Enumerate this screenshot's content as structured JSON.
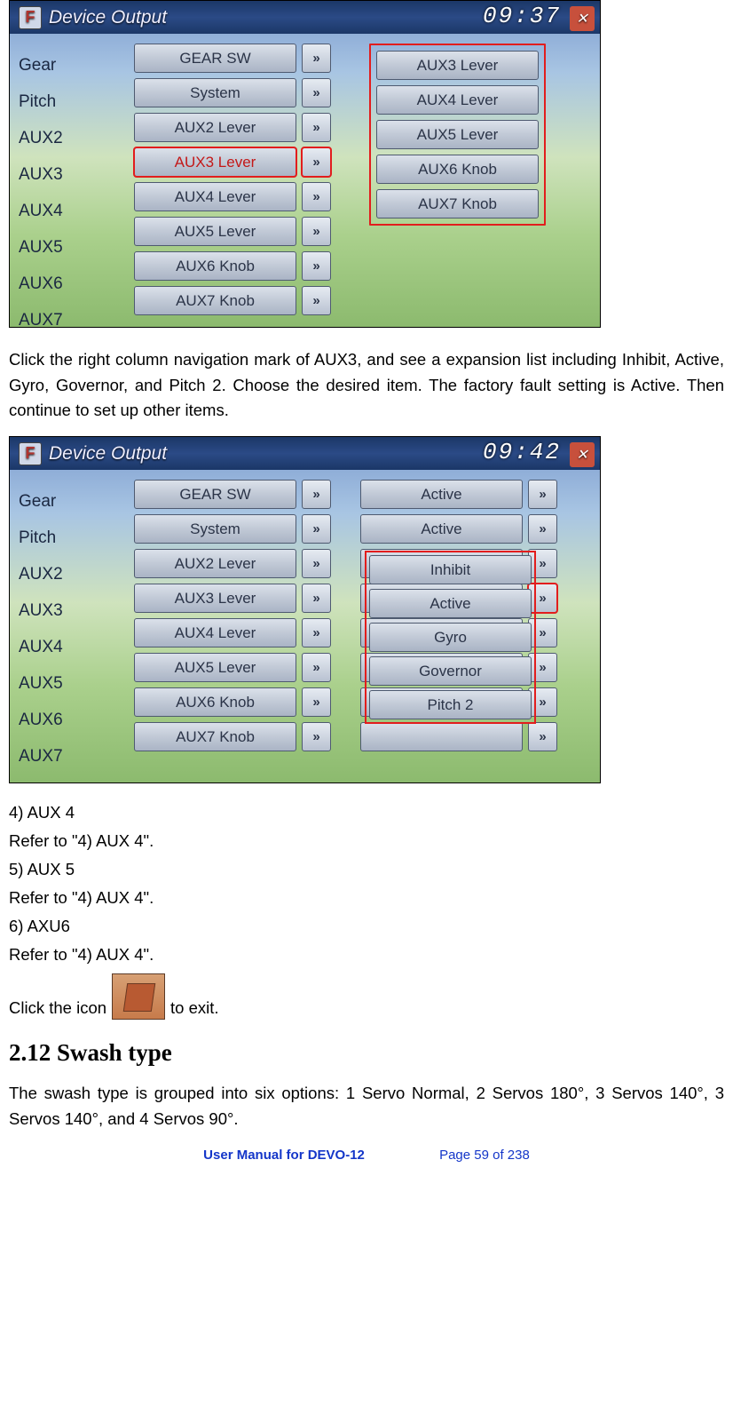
{
  "shotA": {
    "title": "Device Output",
    "clock": "09:37",
    "labels": [
      "Gear",
      "Pitch",
      "AUX2",
      "AUX3",
      "AUX4",
      "AUX5",
      "AUX6",
      "AUX7"
    ],
    "left_buttons": [
      "GEAR SW",
      "System",
      "AUX2 Lever",
      "AUX3 Lever",
      "AUX4 Lever",
      "AUX5 Lever",
      "AUX6 Knob",
      "AUX7 Knob"
    ],
    "popup": [
      "AUX3 Lever",
      "AUX4 Lever",
      "AUX5 Lever",
      "AUX6 Knob",
      "AUX7 Knob"
    ],
    "highlight_row_index": 3
  },
  "para1": "Click the right column navigation mark of AUX3, and see a expansion list including Inhibit, Active, Gyro, Governor, and Pitch 2. Choose the desired item. The factory fault setting is Active. Then continue to set up other items.",
  "shotB": {
    "title": "Device Output",
    "clock": "09:42",
    "labels": [
      "Gear",
      "Pitch",
      "AUX2",
      "AUX3",
      "AUX4",
      "AUX5",
      "AUX6",
      "AUX7"
    ],
    "left_buttons": [
      "GEAR SW",
      "System",
      "AUX2 Lever",
      "AUX3 Lever",
      "AUX4 Lever",
      "AUX5 Lever",
      "AUX6 Knob",
      "AUX7 Knob"
    ],
    "right_buttons": [
      "Active",
      "Active",
      "",
      "",
      "",
      "",
      "",
      ""
    ],
    "popup": [
      "Inhibit",
      "Active",
      "Gyro",
      "Governor",
      "Pitch 2"
    ]
  },
  "seq": {
    "n4": "4)    AUX 4",
    "r4": "Refer to \"4) AUX 4\".",
    "n5": "5)    AUX 5",
    "r5": "Refer to \"4) AUX 4\".",
    "n6": "6)    AXU6",
    "r6": "Refer to \"4) AUX 4\"."
  },
  "iconline_pre": "Click the icon",
  "iconline_post": " to exit.",
  "section_heading": "2.12 Swash type",
  "para_swash": "The swash type is grouped into six options: 1 Servo Normal, 2 Servos 180°, 3 Servos 140°, 3 Servos 140°, and 4 Servos 90°.",
  "footer_manual": "User Manual for DEVO-12",
  "footer_page": "Page 59 of 238"
}
